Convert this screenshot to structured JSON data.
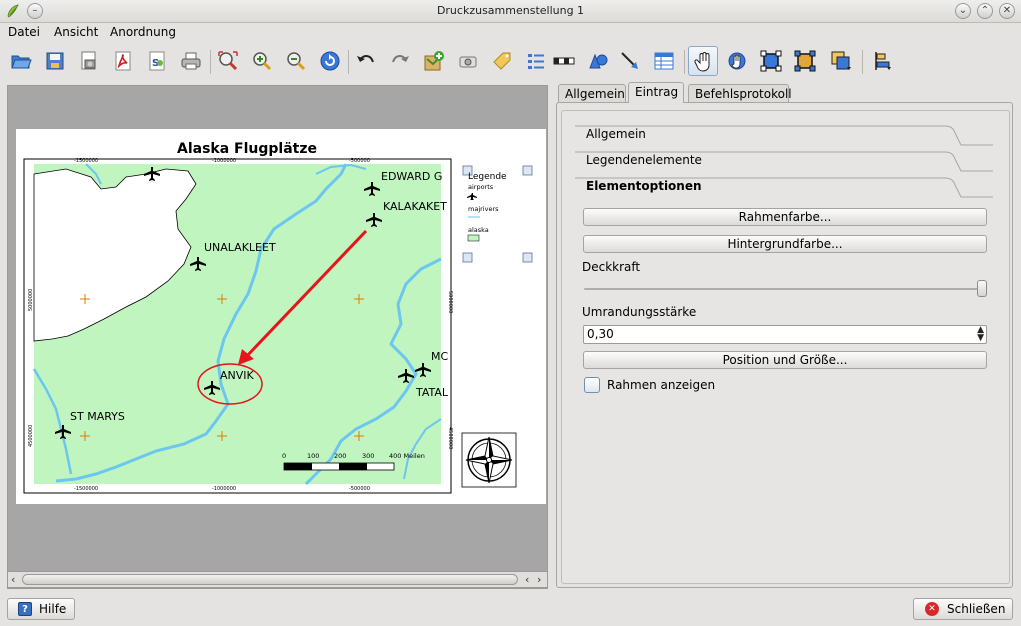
{
  "window": {
    "title": "Druckzusammenstellung 1"
  },
  "menu": {
    "file": "Datei",
    "view": "Ansicht",
    "arrange": "Anordnung"
  },
  "map": {
    "title": "Alaska Flugplätze",
    "places": {
      "edward": "EDWARD G",
      "kalakaket": "KALAKAKET",
      "unalakleet": "UNALAKLEET",
      "anvik": "ANVIK",
      "st_marys": "ST MARYS",
      "mc": "MC",
      "tatal": "TATAL"
    },
    "grid_labels": {
      "top1": "-1500000",
      "top2": "-1000000",
      "top3": "-500000",
      "bottom1": "-1500000",
      "bottom2": "-1000000",
      "bottom3": "-500000",
      "left1": "5000000",
      "left2": "4500000",
      "right1": "5000000",
      "right2": "4500000"
    },
    "scalebar": {
      "t0": "0",
      "t1": "100",
      "t2": "200",
      "t3": "300",
      "t4": "400 Meilen"
    }
  },
  "legend": {
    "title": "Legende",
    "airports": "airports",
    "majrivers": "majrivers",
    "alaska": "alaska"
  },
  "tabs": {
    "general": "Allgemein",
    "item": "Eintrag",
    "command_history": "Befehlsprotokoll"
  },
  "panel": {
    "section_general": "Allgemein",
    "section_elements": "Legendenelemente",
    "section_options": "Elementoptionen",
    "frame_color_button": "Rahmenfarbe...",
    "background_color_button": "Hintergrundfarbe...",
    "opacity_label": "Deckkraft",
    "opacity": 1.0,
    "outline_width_label": "Umrandungsstärke",
    "outline_width_value": "0,30",
    "position_size_button": "Position und Größe...",
    "show_frame_label": "Rahmen anzeigen",
    "show_frame_checked": false
  },
  "buttons": {
    "help": "Hilfe",
    "close": "Schließen"
  },
  "colors": {
    "land": "#c0f5c0",
    "water": "#6cc6ef",
    "arrow": "#e8141a"
  }
}
